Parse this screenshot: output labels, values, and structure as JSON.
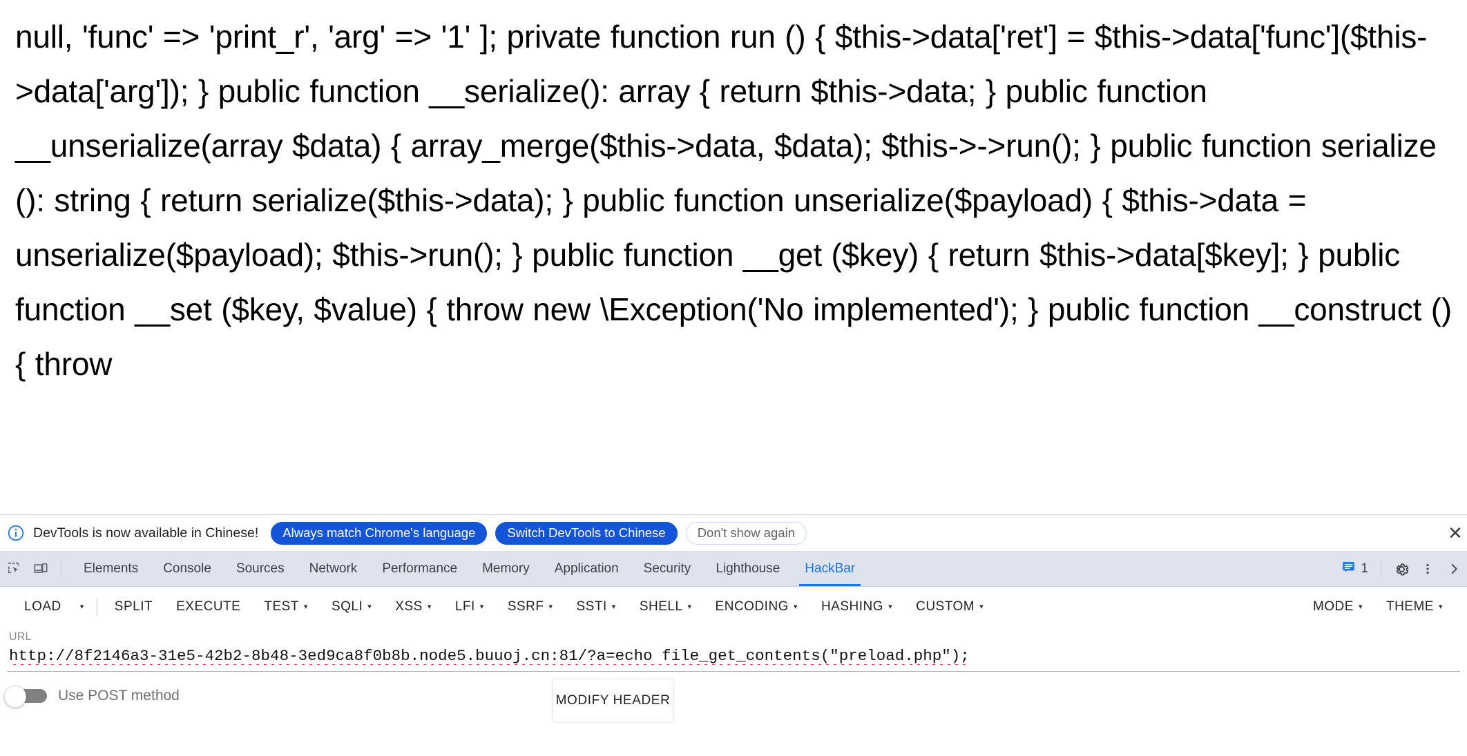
{
  "page": {
    "source_text": "null, 'func' => 'print_r', 'arg' => '1' ]; private function run () { $this->data['ret'] = $this->data['func']($this->data['arg']); } public function __serialize(): array { return $this->data; } public function __unserialize(array $data) { array_merge($this->data, $data); $this->->run(); } public function serialize (): string { return serialize($this->data); } public function unserialize($payload) { $this->data = unserialize($payload); $this->run(); } public function __get ($key) { return $this->data[$key]; } public function __set ($key, $value) { throw new \\Exception('No implemented'); } public function __construct () { throw"
  },
  "infobar": {
    "icon": "info-circle-icon",
    "message": "DevTools is now available in Chinese!",
    "buttons": [
      {
        "label": "Always match Chrome's language",
        "style": "primary"
      },
      {
        "label": "Switch DevTools to Chinese",
        "style": "primary"
      },
      {
        "label": "Don't show again",
        "style": "ghost"
      }
    ],
    "close_label": "✕"
  },
  "devtools": {
    "left_icons": [
      {
        "name": "inspect-element-icon"
      },
      {
        "name": "device-toolbar-icon"
      }
    ],
    "tabs": [
      {
        "label": "Elements",
        "selected": false
      },
      {
        "label": "Console",
        "selected": false
      },
      {
        "label": "Sources",
        "selected": false
      },
      {
        "label": "Network",
        "selected": false
      },
      {
        "label": "Performance",
        "selected": false
      },
      {
        "label": "Memory",
        "selected": false
      },
      {
        "label": "Application",
        "selected": false
      },
      {
        "label": "Security",
        "selected": false
      },
      {
        "label": "Lighthouse",
        "selected": false
      },
      {
        "label": "HackBar",
        "selected": true
      }
    ],
    "right": {
      "message_count": "1",
      "message_icon": "message-icon",
      "settings_icon": "gear-icon",
      "more_icon": "kebab-menu-icon",
      "close_icon": "chevron-right-icon"
    }
  },
  "hackbar": {
    "menu": [
      {
        "label": "LOAD",
        "caret": false
      },
      {
        "label": "",
        "caret": true,
        "caret_only": true
      },
      {
        "label": "SPLIT",
        "caret": false
      },
      {
        "label": "EXECUTE",
        "caret": false
      },
      {
        "label": "TEST",
        "caret": true
      },
      {
        "label": "SQLI",
        "caret": true
      },
      {
        "label": "XSS",
        "caret": true
      },
      {
        "label": "LFI",
        "caret": true
      },
      {
        "label": "SSRF",
        "caret": true
      },
      {
        "label": "SSTI",
        "caret": true
      },
      {
        "label": "SHELL",
        "caret": true
      },
      {
        "label": "ENCODING",
        "caret": true
      },
      {
        "label": "HASHING",
        "caret": true
      },
      {
        "label": "CUSTOM",
        "caret": true
      }
    ],
    "menu_right": [
      {
        "label": "MODE",
        "caret": true
      },
      {
        "label": "THEME",
        "caret": true
      }
    ],
    "url_label": "URL",
    "url_value": "http://8f2146a3-31e5-42b2-8b48-3ed9ca8f0b8b.node5.buuoj.cn:81/?a=echo file_get_contents(\"preload.php\");",
    "post_toggle_label": "Use POST method",
    "post_toggle_on": false,
    "modify_header_label": "MODIFY HEADER"
  },
  "colors": {
    "accent_blue": "#1a73e8",
    "pill_blue": "#1355d6",
    "tabstrip_bg": "#dee3ee",
    "spellcheck_red": "#e53935"
  }
}
